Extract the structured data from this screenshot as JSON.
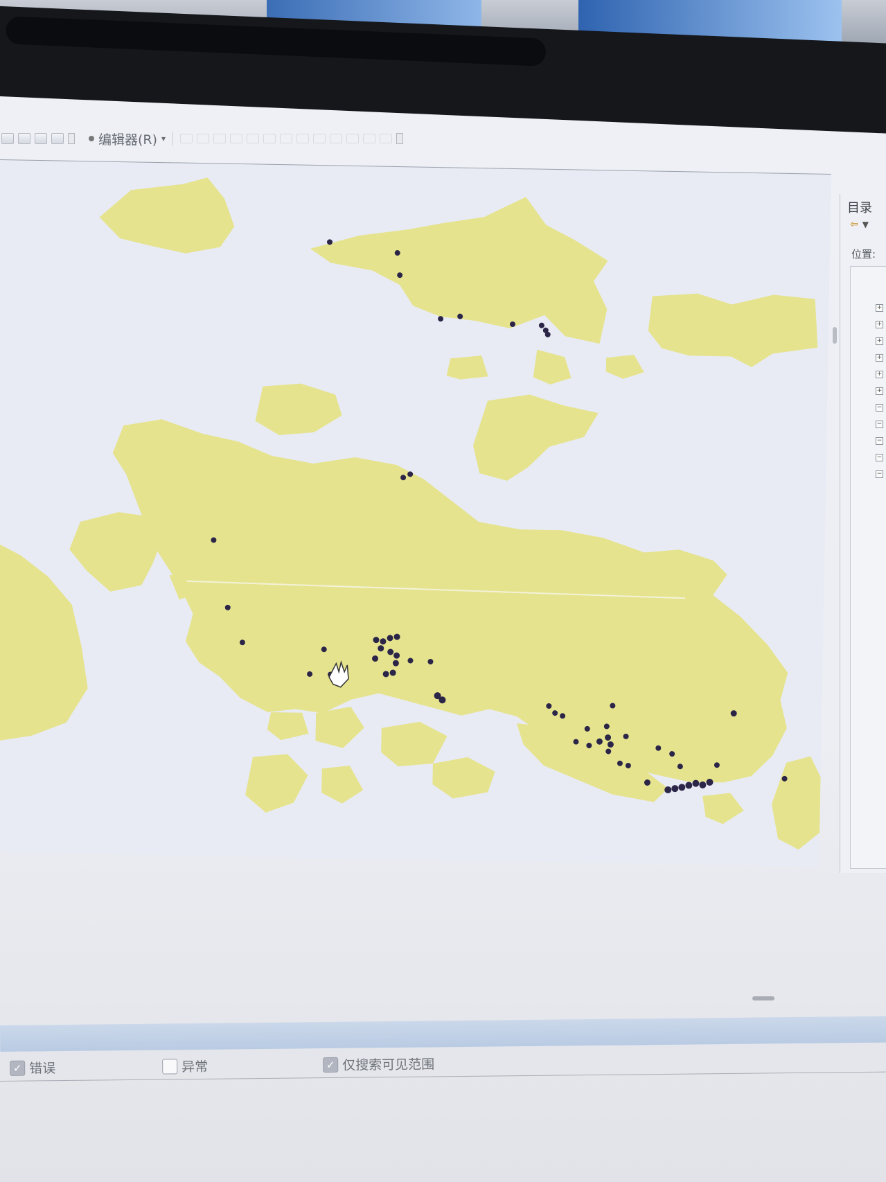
{
  "toolbar": {
    "editor_label": "编辑器(R)",
    "editor_dropdown": "▾"
  },
  "catalog": {
    "title": "目录",
    "location_label": "位置:",
    "back_icon": "back-arrow-icon",
    "tree_expanders": [
      "+",
      "+",
      "+",
      "+",
      "+",
      "+",
      "−",
      "−",
      "−",
      "−",
      "−"
    ]
  },
  "map": {
    "land_color": "#e6e38f",
    "water_color": "#e8ebf4",
    "point_color": "#2b2548",
    "cursor": "pan-hand-icon"
  },
  "bottom_panel": {
    "checkbox_error": {
      "label": "错误",
      "checked": true
    },
    "checkbox_exception": {
      "label": "异常",
      "checked": false
    },
    "checkbox_visible": {
      "label": "仅搜索可见范围",
      "checked": true
    }
  }
}
